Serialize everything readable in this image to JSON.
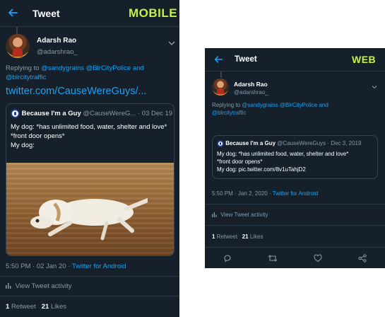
{
  "mobile": {
    "header": {
      "title": "Tweet",
      "tag": "MOBILE"
    },
    "author": {
      "name": "Adarsh Rao",
      "handle": "@adarshrao_"
    },
    "reply": {
      "prefix": "Replying to",
      "mention1": "@sandygrains",
      "mention2": "@BlrCityPolice",
      "and": "and",
      "mention3": "@blrcitytraffic"
    },
    "url": "twitter.com/CauseWereGuys/...",
    "quote": {
      "name": "Because I'm a Guy",
      "handle": "@CauseWereG...",
      "date": "· 03 Dec 19",
      "line1": "My dog: *has unlimited food, water, shelter and love*",
      "line2": "*front door opens*",
      "line3": "My dog:"
    },
    "meta": {
      "time": "5:50 PM · 02 Jan 20 · ",
      "source": "Twitter for Android"
    },
    "activity": "View Tweet activity",
    "stats": {
      "retweets": "1",
      "retweets_label": "Retweet",
      "likes": "21",
      "likes_label": "Likes"
    }
  },
  "web": {
    "header": {
      "title": "Tweet",
      "tag": "WEB"
    },
    "author": {
      "name": "Adarsh Rao",
      "handle": "@adarshrao_"
    },
    "reply": {
      "prefix": "Replying to",
      "mention1": "@sandygrains",
      "mention2": "@BlrCityPolice",
      "and": "and",
      "mention3": "@blrcitytraffic"
    },
    "quote": {
      "name": "Because I'm a Guy",
      "handle": "@CauseWereGuys",
      "date": "· Dec 3, 2019",
      "line1": "My dog: *has unlimited food, water, shelter and love*",
      "line2": "*front door opens*",
      "line3": "My dog: pic.twitter.com/8v1uTahjD2"
    },
    "meta": {
      "time": "5:50 PM · Jan 2, 2020 · ",
      "source": "Twitter for Android"
    },
    "activity": "View Tweet activity",
    "stats": {
      "retweets": "1",
      "retweets_label": "Retweet",
      "likes": "21",
      "likes_label": "Likes"
    }
  },
  "colors": {
    "background": "#15202b",
    "accent": "#1da1f2",
    "tag": "#c5f046",
    "muted": "#8899a6"
  },
  "icons": [
    "back-arrow-icon",
    "chevron-down-icon",
    "bar-chart-icon",
    "reply-icon",
    "retweet-icon",
    "heart-icon",
    "share-icon"
  ]
}
